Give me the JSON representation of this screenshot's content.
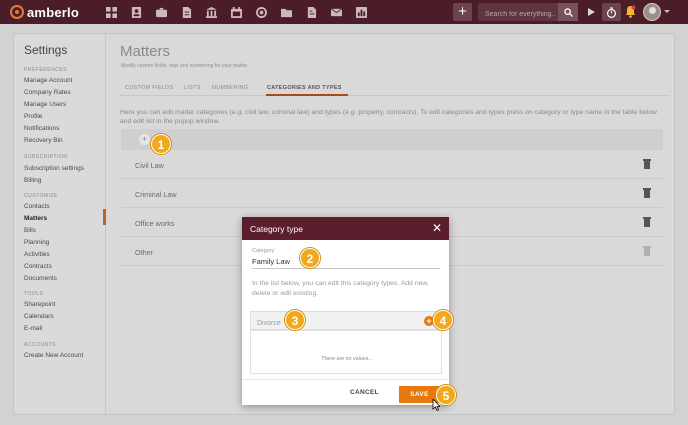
{
  "app": {
    "logo_text": "amberlo"
  },
  "topbar": {
    "nav_icons": [
      "dashboard-icon",
      "contacts-icon",
      "briefcase-icon",
      "document-icon",
      "bank-icon",
      "calendar-icon",
      "phone-icon",
      "folder-icon",
      "invoice-icon",
      "mail-icon",
      "reports-icon"
    ],
    "add_label": "+",
    "search_placeholder": "Search for everything..."
  },
  "sidebar": {
    "title": "Settings",
    "sections": [
      {
        "label": "PREFERENCES",
        "items": [
          "Manage Account",
          "Company Rates",
          "Manage Users",
          "Profile",
          "Notifications",
          "Recovery Bin"
        ]
      },
      {
        "label": "SUBSCRIPTION",
        "items": [
          "Subscription settings",
          "Billing"
        ]
      },
      {
        "label": "CUSTOMIZE",
        "items": [
          "Contacts",
          "Matters",
          "Bills",
          "Planning",
          "Activities",
          "Contracts",
          "Documents"
        ]
      },
      {
        "label": "TOOLS",
        "items": [
          "Sharepoint",
          "Calendars",
          "E-mail"
        ]
      },
      {
        "label": "ACCOUNTS",
        "items": [
          "Create New Account"
        ]
      }
    ],
    "active_item": "Matters"
  },
  "main": {
    "title": "Matters",
    "subtitle": "Modify custom fields, tags and numbering for your matter.",
    "tabs": [
      "CUSTOM FIELDS",
      "LISTS",
      "NUMBERING",
      "CATEGORIES AND TYPES"
    ],
    "active_tab": "CATEGORIES AND TYPES",
    "description": "Here you can edit matter categories (e.g. civil law, criminal law) and types (e.g. property, contracts). To edit categories and types press on category or type name in the table below and edit list in the popup window.",
    "add_label": "+",
    "categories": [
      "Civil Law",
      "Criminal Law",
      "Office works",
      "Other"
    ]
  },
  "modal": {
    "title": "Category type",
    "close_label": "✕",
    "field_label": "Category",
    "field_value": "Family Law",
    "description": "In the list below, you can edit this category types. Add new, delete or edit existing.",
    "type_placeholder": "Divorce",
    "add_label": "+",
    "empty_text": "There are no values...",
    "cancel_label": "CANCEL",
    "save_label": "SAVE"
  },
  "callouts": [
    "1",
    "2",
    "3",
    "4",
    "5"
  ],
  "colors": {
    "topbar": "#4a1d28",
    "modal_header": "#5a1e2c",
    "accent": "#e5780f",
    "callout": "#f2a81a"
  }
}
